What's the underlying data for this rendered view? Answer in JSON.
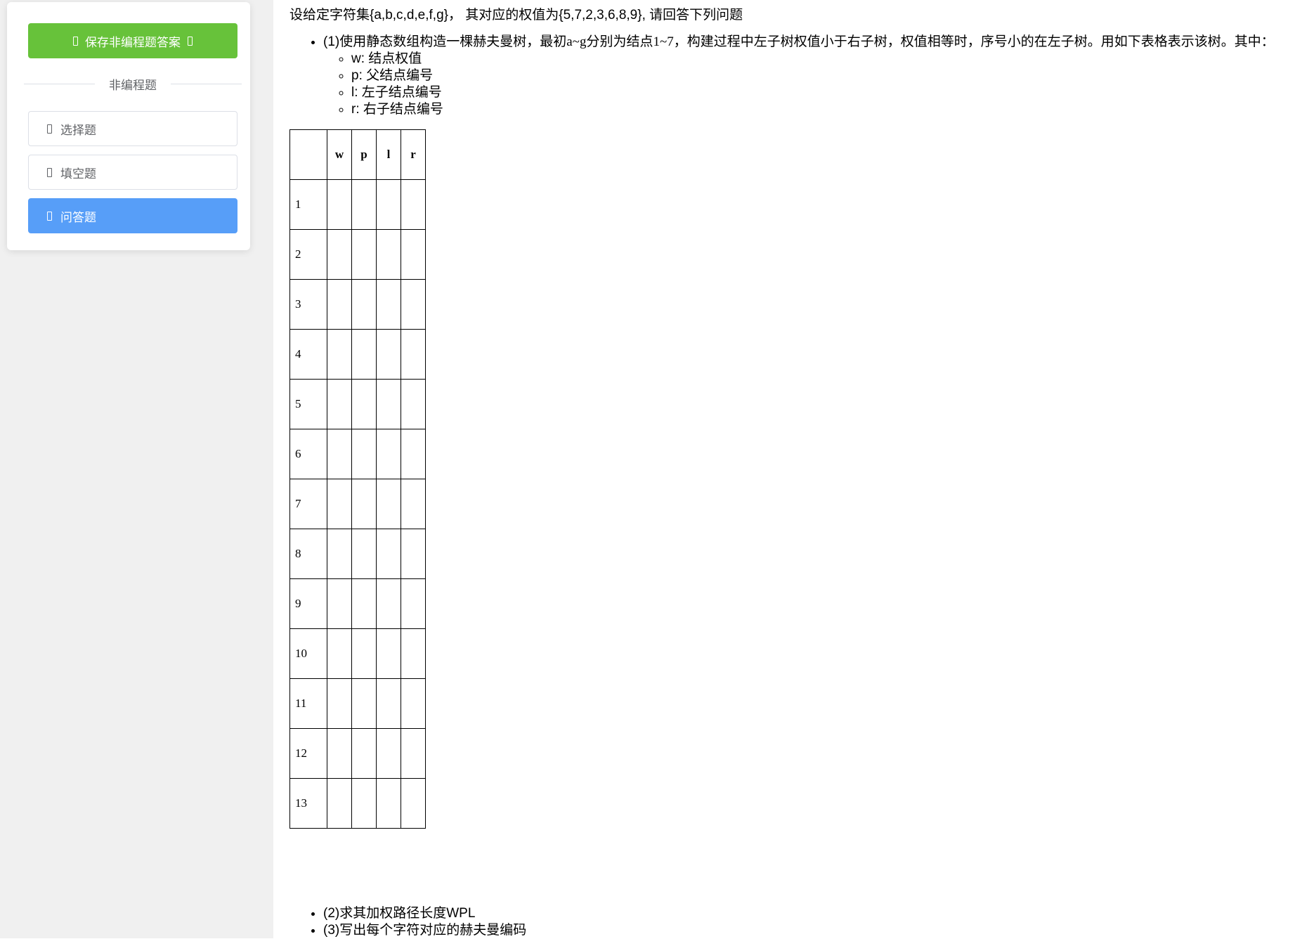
{
  "sidebar": {
    "save_button_label": "保存非编程题答案",
    "section_title": "非编程题",
    "items": [
      {
        "label": "选择题",
        "active": false
      },
      {
        "label": "填空题",
        "active": false
      },
      {
        "label": "问答题",
        "active": true
      }
    ]
  },
  "colors": {
    "save_button": "#67c23a",
    "active_item": "#579ef8",
    "sidebar_bg": "#f0f0f0"
  },
  "content": {
    "question": "设给定字符集{a,b,c,d,e,f,g}， 其对应的权值为{5,7,2,3,6,8,9}, 请回答下列问题",
    "part1": {
      "prefix": "(1)",
      "text": "使用静态数组构造一棵赫夫曼树，最初a~g分别为结点1~7，构建过程中左子树权值小于右子树，权值相等时，序号小的在左子树。用如下表格表示该树。其中："
    },
    "legend": [
      {
        "key": "w",
        "desc": "结点权值"
      },
      {
        "key": "p",
        "desc": "父结点编号"
      },
      {
        "key": "l",
        "desc": "左子结点编号"
      },
      {
        "key": "r",
        "desc": "右子结点编号"
      }
    ],
    "table": {
      "columns": [
        "w",
        "p",
        "l",
        "r"
      ],
      "rows": [
        "1",
        "2",
        "3",
        "4",
        "5",
        "6",
        "7",
        "8",
        "9",
        "10",
        "11",
        "12",
        "13"
      ]
    },
    "part2": {
      "prefix": "(2)",
      "text": "求其加权路径长度",
      "suffix": "WPL"
    },
    "part3": {
      "prefix": "(3)",
      "text": "写出每个字符对应的赫夫曼编码"
    }
  }
}
